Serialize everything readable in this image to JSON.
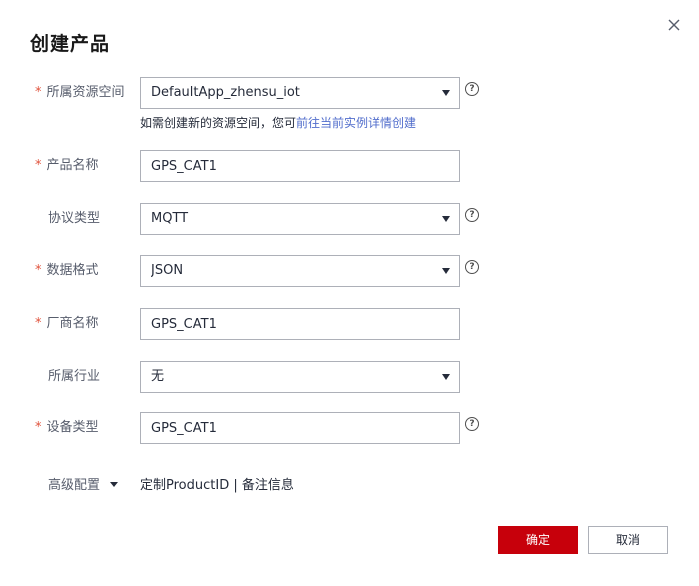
{
  "dialog": {
    "title": "创建产品",
    "required_mark": "*",
    "help_glyph": "?"
  },
  "fields": {
    "resource_space": {
      "label": "所属资源空间",
      "value": "DefaultApp_zhensu_iot"
    },
    "resource_hint": {
      "text": "如需创建新的资源空间，您可",
      "link": "前往当前实例详情创建"
    },
    "product_name": {
      "label": "产品名称",
      "value": "GPS_CAT1"
    },
    "protocol": {
      "label": "协议类型",
      "value": "MQTT"
    },
    "data_format": {
      "label": "数据格式",
      "value": "JSON"
    },
    "vendor_name": {
      "label": "厂商名称",
      "value": "GPS_CAT1"
    },
    "industry": {
      "label": "所属行业",
      "value": "无"
    },
    "device_type": {
      "label": "设备类型",
      "value": "GPS_CAT1"
    }
  },
  "advanced": {
    "label": "高级配置",
    "description": "定制ProductID | 备注信息"
  },
  "footer": {
    "confirm": "确定",
    "cancel": "取消"
  },
  "colors": {
    "primary": "#c7000b",
    "link": "#526ecc",
    "required": "#e0523c"
  },
  "icons": {
    "close": "close-icon",
    "help": "help-circle-icon",
    "dropdown": "chevron-down-icon"
  }
}
